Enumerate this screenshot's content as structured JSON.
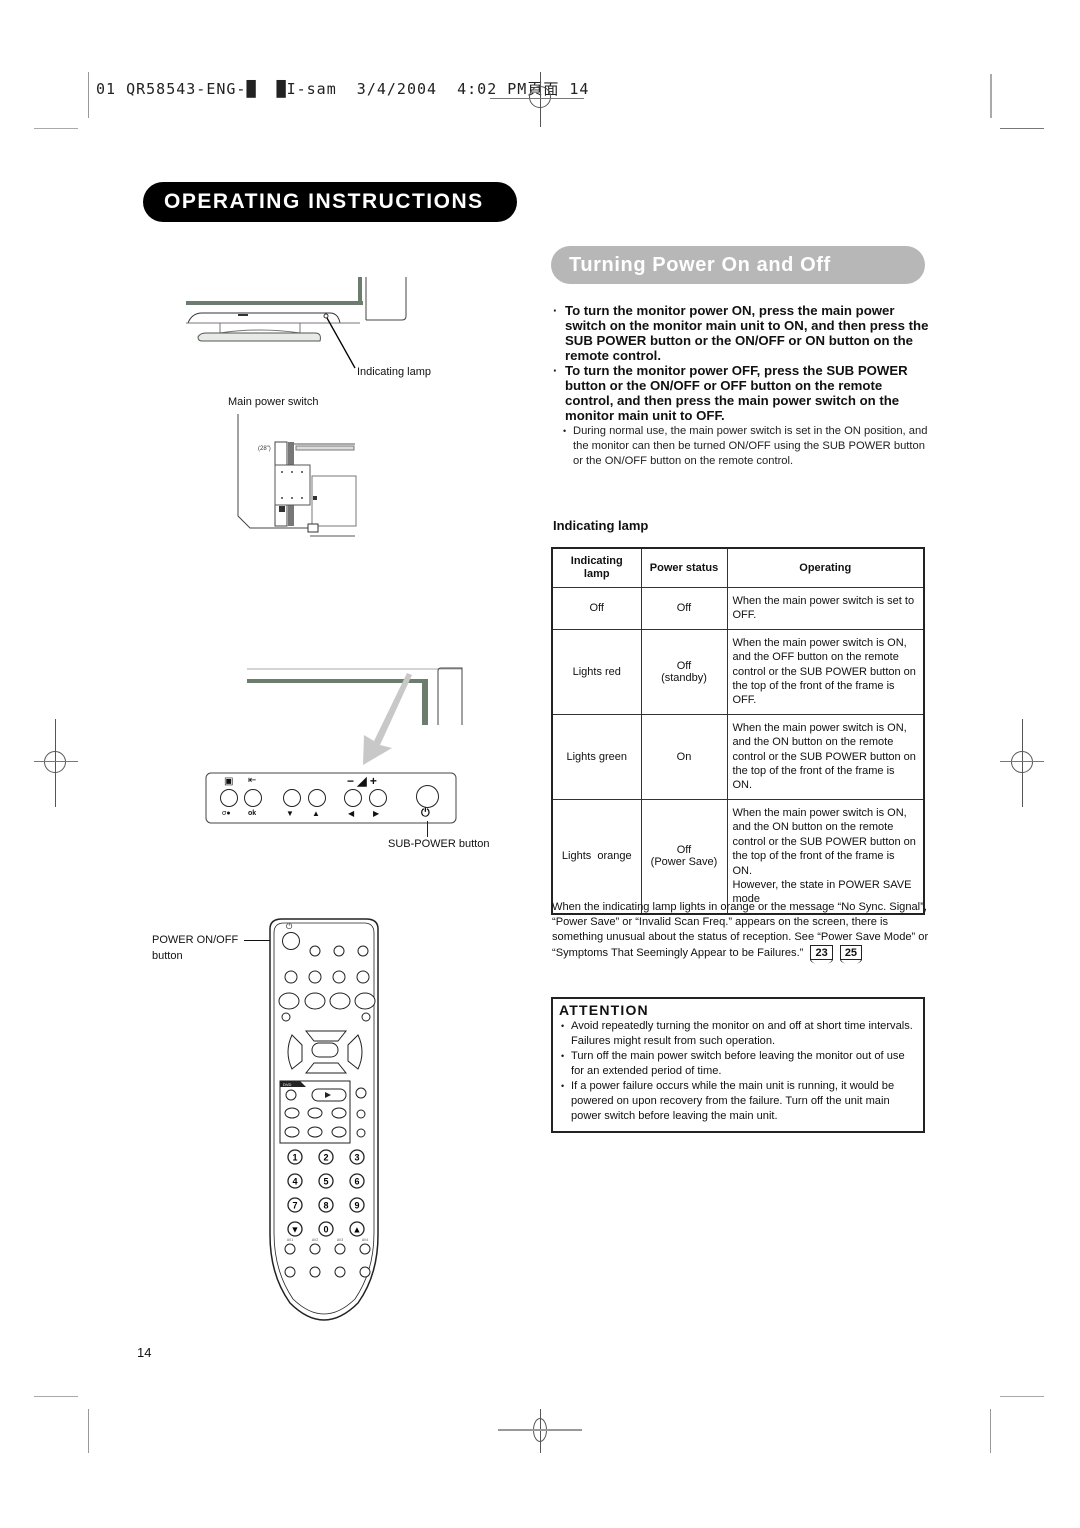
{
  "print_slug": {
    "text": "01 QR58543-ENG-█  █I-sam  3/4/2004  4:02 PM頁面 14"
  },
  "header": {
    "title": "OPERATING INSTRUCTIONS"
  },
  "section": {
    "title": "Turning Power On and Off",
    "bullets": [
      "To turn the monitor power ON, press the main power switch on the monitor main unit to ON, and then press the SUB POWER button or the ON/OFF or ON button on the remote control.",
      "To turn the monitor power OFF, press the SUB POWER button or the ON/OFF or OFF button on the remote control, and then press the main power switch on the monitor main unit to OFF."
    ],
    "sub_note": "During normal use, the main power switch is set in the ON position, and the monitor can then be turned ON/OFF using the SUB POWER button or the ON/OFF button on the remote control."
  },
  "lamp_table": {
    "heading": "Indicating lamp",
    "columns": [
      "Indicating lamp",
      "Power status",
      "Operating"
    ],
    "rows": [
      {
        "lamp": "Off",
        "status": "Off",
        "status2": "",
        "operating": "When the main power switch is set to OFF."
      },
      {
        "lamp": "Lights red",
        "status": "Off",
        "status2": "(standby)",
        "operating": "When the main power switch is ON, and the OFF button on the remote control or the SUB POWER button on the top of the front of the frame is OFF."
      },
      {
        "lamp": "Lights green",
        "status": "On",
        "status2": "",
        "operating": "When the main power switch is ON, and the ON button on the remote control or the SUB POWER button on the top of the front of the frame is ON."
      },
      {
        "lamp": "Lights  orange",
        "status": "Off",
        "status2": "(Power Save)",
        "operating": "When the main power switch is ON, and the ON button on the remote control or the SUB POWER button on the top of the front of the frame is ON.",
        "operating2": "However, the state in POWER SAVE mode"
      }
    ]
  },
  "note": {
    "text": "When the indicating lamp lights in orange or the message “No Sync. Signal”, “Power Save” or “Invalid Scan Freq.” appears on the screen, there is something unusual about the status of reception. See “Power Save Mode” or “Symptoms That Seemingly Appear to be Failures.”",
    "page_refs": [
      "23",
      "25"
    ]
  },
  "attention": {
    "title": "ATTENTION",
    "items": [
      "Avoid repeatedly turning the monitor on and off at short time intervals. Failures might result from such operation.",
      "Turn off the main power switch before leaving the monitor out of use for an extended period of time.",
      "If a power failure occurs while the main unit is running, it would be powered on upon recovery from the failure. Turn off the unit main power switch before leaving the main unit."
    ]
  },
  "illustrations": {
    "monitor_front": {
      "label_lamp": "Indicating lamp"
    },
    "monitor_back": {
      "label_switch": "Main power switch",
      "size_tag": "(28\")"
    },
    "control_panel": {
      "label": "SUB-POWER button",
      "button_symbols": [
        "▭ / σ●",
        "←□ / ok",
        "▼",
        "▲",
        "◀",
        "▶",
        "⏻"
      ],
      "volume_symbol": "− ◢ +"
    },
    "remote": {
      "label_line1": "POWER ON/OFF",
      "label_line2": "button",
      "numbers": [
        "1",
        "2",
        "3",
        "4",
        "5",
        "6",
        "7",
        "8",
        "9",
        "▼",
        "0",
        "▲"
      ],
      "av_labels": [
        "AV1",
        "AV2",
        "AV3",
        "AV4"
      ],
      "section_tag": "DVD"
    }
  },
  "page_number": "14"
}
